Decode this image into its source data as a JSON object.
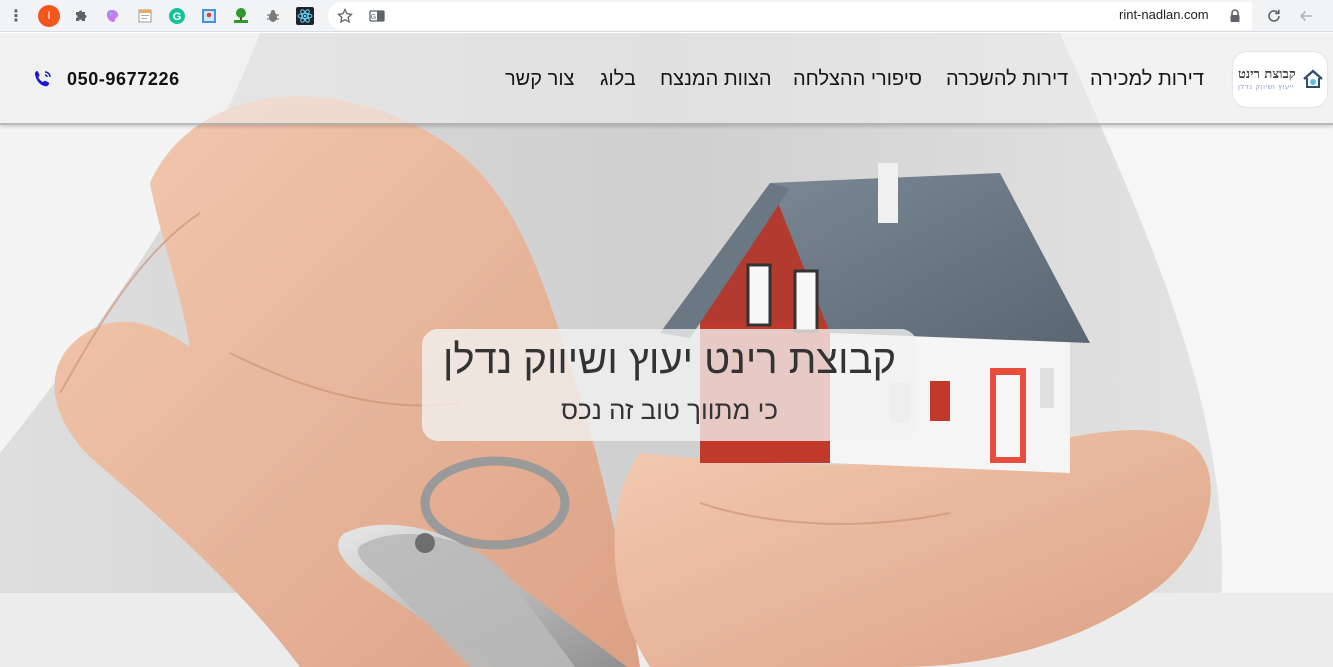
{
  "browser": {
    "url": "rint-nadlan.com",
    "extensions": [
      "orange-extension-icon",
      "puzzle-icon",
      "paint-icon",
      "note-icon",
      "grammarly-icon",
      "map-icon",
      "html-tree-icon",
      "bug-icon",
      "react-icon"
    ],
    "orange_ext_letter": "I"
  },
  "site": {
    "logo": {
      "name": "קבוצת רינט",
      "tagline": "ייעוץ ושיווק נדלן"
    },
    "nav": {
      "sale": "דירות למכירה",
      "rent": "דירות להשכרה",
      "stories": "סיפורי ההצלחה",
      "team": "הצוות המנצח",
      "blog": "בלוג",
      "contact": "צור קשר"
    },
    "phone": "050-9677226",
    "hero": {
      "title": "קבוצת רינט יעוץ ושיווק נדלן",
      "subtitle": "כי מתווך טוב זה נכס"
    },
    "colors": {
      "phone_icon": "#1a1ad0",
      "nav_text": "#161616"
    }
  }
}
